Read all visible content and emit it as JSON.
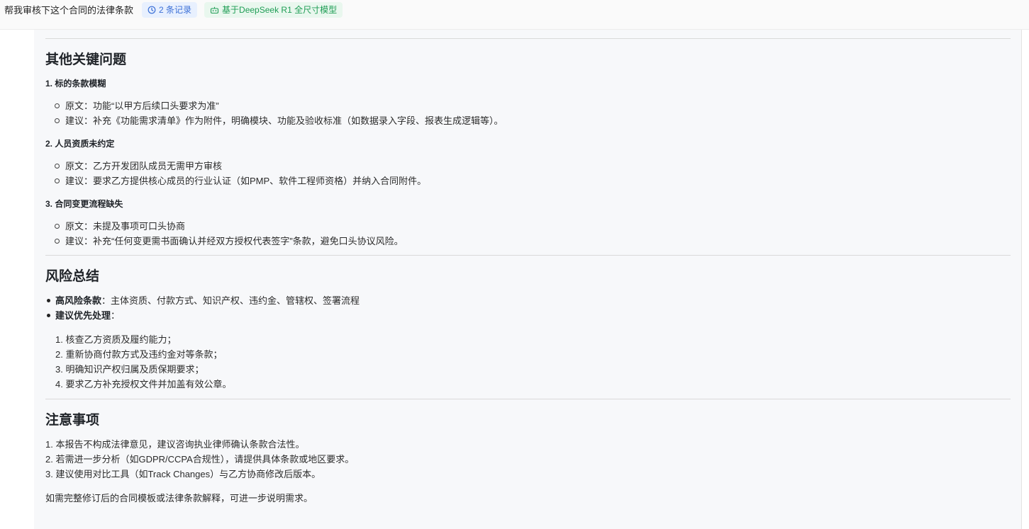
{
  "header": {
    "query": "帮我审核下这个合同的法律条款",
    "records_label": "2 条记录",
    "model_label": "基于DeepSeek R1 全尺寸模型"
  },
  "sections": {
    "other": {
      "title": "其他关键问题",
      "items": [
        {
          "heading": "1. 标的条款模糊",
          "bullets": [
            "原文：功能“以甲方后续口头要求为准”",
            "建议：补充《功能需求清单》作为附件，明确模块、功能及验收标准（如数据录入字段、报表生成逻辑等）。"
          ]
        },
        {
          "heading": "2. 人员资质未约定",
          "bullets": [
            "原文：乙方开发团队成员无需甲方审核",
            "建议：要求乙方提供核心成员的行业认证（如PMP、软件工程师资格）并纳入合同附件。"
          ]
        },
        {
          "heading": "3. 合同变更流程缺失",
          "bullets": [
            "原文：未提及事项可口头协商",
            "建议：补充“任何变更需书面确认并经双方授权代表签字”条款，避免口头协议风险。"
          ]
        }
      ]
    },
    "risk": {
      "title": "风险总结",
      "high_label": "高风险条款",
      "high_text": "：主体资质、付款方式、知识产权、违约金、管辖权、签署流程",
      "priority_label": "建议优先处理",
      "priority_suffix": "：",
      "steps": [
        "1. 核查乙方资质及履约能力；",
        "2. 重新协商付款方式及违约金对等条款；",
        "3. 明确知识产权归属及质保期要求；",
        "4. 要求乙方补充授权文件并加盖有效公章。"
      ]
    },
    "notes": {
      "title": "注意事项",
      "lines": [
        "1. 本报告不构成法律意见，建议咨询执业律师确认条款合法性。",
        "2. 若需进一步分析（如GDPR/CCPA合规性），请提供具体条款或地区要求。",
        "3. 建议使用对比工具（如Track Changes）与乙方协商修改后版本。"
      ],
      "closing": "如需完整修订后的合同模板或法律条款解释，可进一步说明需求。"
    }
  }
}
